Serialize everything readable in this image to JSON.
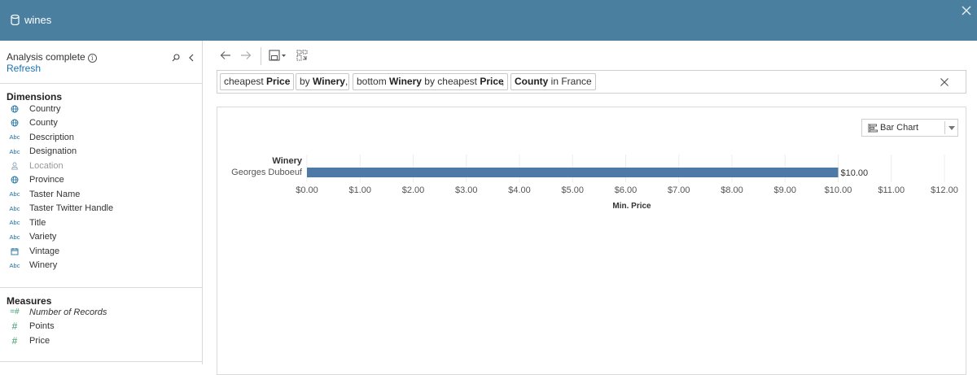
{
  "window": {
    "title": "wines"
  },
  "sidebar": {
    "status": "Analysis complete",
    "refresh": "Refresh",
    "dimensions_title": "Dimensions",
    "dimensions": [
      {
        "label": "Country",
        "icon": "globe"
      },
      {
        "label": "County",
        "icon": "globe"
      },
      {
        "label": "Description",
        "icon": "Abc"
      },
      {
        "label": "Designation",
        "icon": "Abc"
      },
      {
        "label": "Location",
        "icon": "location"
      },
      {
        "label": "Province",
        "icon": "globe"
      },
      {
        "label": "Taster Name",
        "icon": "Abc"
      },
      {
        "label": "Taster Twitter Handle",
        "icon": "Abc"
      },
      {
        "label": "Title",
        "icon": "Abc"
      },
      {
        "label": "Variety",
        "icon": "Abc"
      },
      {
        "label": "Vintage",
        "icon": "calendar"
      },
      {
        "label": "Winery",
        "icon": "Abc"
      }
    ],
    "measures_title": "Measures",
    "measures": [
      {
        "label": "Number of Records",
        "icon": "=#"
      },
      {
        "label": "Points",
        "icon": "#"
      },
      {
        "label": "Price",
        "icon": "#"
      }
    ]
  },
  "query": {
    "pills": [
      {
        "pre": "cheapest ",
        "bold": "Price",
        "post": ""
      },
      {
        "pre": "by ",
        "bold": "Winery",
        "post": ""
      },
      {
        "pre": "bottom ",
        "bold": "Winery",
        "post": " by cheapest ",
        "bold2": "Price"
      },
      {
        "pre": "",
        "bold": "County",
        "post": " in France"
      }
    ]
  },
  "viz": {
    "chart_type_label": "Bar Chart"
  },
  "chart_data": {
    "type": "bar",
    "orientation": "horizontal",
    "ylabel": "Winery",
    "xlabel": "Min. Price",
    "categories": [
      "Georges Duboeuf"
    ],
    "values": [
      10.0
    ],
    "value_labels": [
      "$10.00"
    ],
    "xlim": [
      0,
      12
    ],
    "x_ticks": [
      "$0.00",
      "$1.00",
      "$2.00",
      "$3.00",
      "$4.00",
      "$5.00",
      "$6.00",
      "$7.00",
      "$8.00",
      "$9.00",
      "$10.00",
      "$11.00",
      "$12.00"
    ],
    "bar_color": "#4e79a7"
  }
}
